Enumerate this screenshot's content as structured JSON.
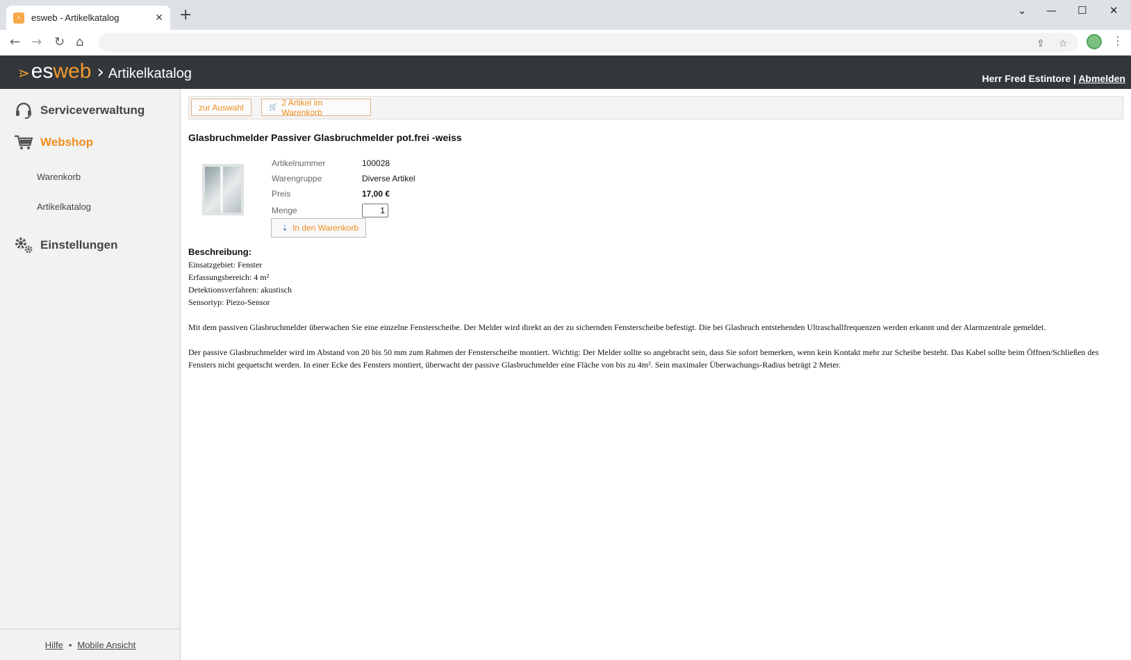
{
  "browser": {
    "tab_title": "esweb - Artikelkatalog",
    "tab_close": "✕",
    "new_tab": "+",
    "controls": {
      "tabsearch": "⌄",
      "minimize": "—",
      "maximize": "☐",
      "close": "✕"
    },
    "nav": {
      "back": "←",
      "forward": "→",
      "reload": "↻",
      "home": "⌂"
    },
    "omnibox_icons": {
      "share": "⇪",
      "bookmark": "☆"
    },
    "menu": "⋮"
  },
  "header": {
    "logo_es": "es",
    "logo_web": "web",
    "section": "Artikelkatalog",
    "user": "Herr Fred Estintore",
    "separator": "|",
    "logout": "Abmelden"
  },
  "sidebar": {
    "main": [
      {
        "label": "Serviceverwaltung",
        "icon": "headset-icon"
      },
      {
        "label": "Webshop",
        "icon": "cart-icon"
      },
      {
        "label": "Einstellungen",
        "icon": "gears-icon"
      }
    ],
    "sub": [
      {
        "label": "Warenkorb"
      },
      {
        "label": "Artikelkatalog"
      }
    ],
    "footer": {
      "help": "Hilfe",
      "dot": "•",
      "mobile": "Mobile Ansicht"
    }
  },
  "actions": {
    "back": "zur Auswahl",
    "cart": "2 Artikel im Warenkorb"
  },
  "product": {
    "title": "Glasbruchmelder Passiver Glasbruchmelder pot.frei -weiss",
    "rows": [
      {
        "label": "Artikelnummer",
        "value": "100028"
      },
      {
        "label": "Warengruppe",
        "value": "Diverse Artikel"
      },
      {
        "label": "Preis",
        "value": "17,00 €"
      }
    ],
    "qty_label": "Menge",
    "qty_value": "1",
    "add_to_cart": "In den Warenkorb"
  },
  "description": {
    "heading": "Beschreibung:",
    "lines": [
      "Einsatzgebiet: Fenster",
      "Erfassungsbereich: 4 m²",
      "Detektionsverfahren: akustisch",
      "Sensortyp: Piezo-Sensor"
    ],
    "para1": "Mit dem passiven Glasbruchmelder überwachen Sie eine einzelne Fensterscheibe. Der Melder wird direkt an der zu sichernden Fensterscheibe befestigt. Die bei Glasbruch entstehenden Ultraschallfrequenzen werden erkannt und der Alarmzentrale gemeldet.",
    "para2": "Der passive Glasbruchmelder wird im Abstand von 20 bis 50 mm zum Rahmen der Fensterscheibe montiert. Wichtig: Der Melder sollte so angebracht sein, dass Sie sofort bemerken, wenn kein Kontakt mehr zur Scheibe besteht. Das Kabel sollte beim Öffnen/Schließen des Fensters nicht gequetscht werden. In einer Ecke des Fensters montiert, überwacht der passive Glasbruchmelder eine Fläche von bis zu 4m². Sein maximaler Überwachungs-Radius beträgt 2 Meter."
  },
  "colors": {
    "accent": "#f08c1e",
    "header_bg": "#33373a",
    "sidebar_bg": "#f2f2f2"
  }
}
